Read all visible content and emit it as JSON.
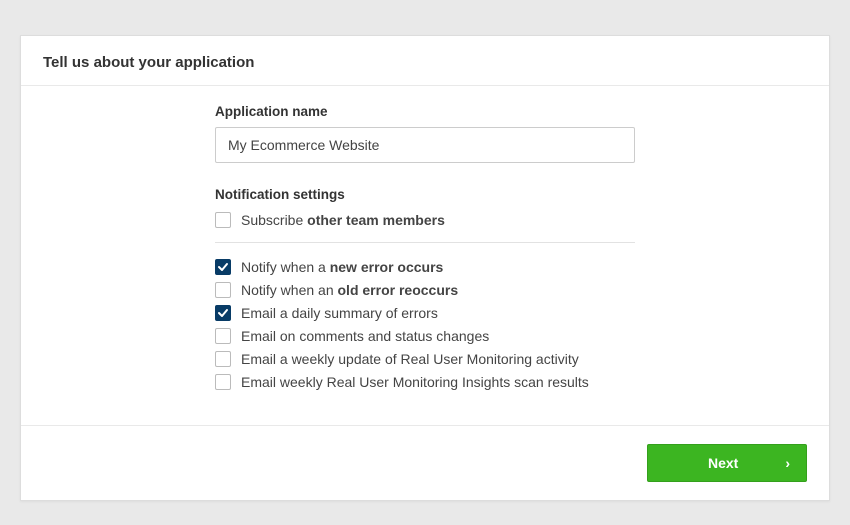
{
  "title": "Tell us about your application",
  "appName": {
    "label": "Application name",
    "value": "My Ecommerce Website"
  },
  "notification": {
    "heading": "Notification settings",
    "subscribe": {
      "checked": false,
      "prefix": "Subscribe ",
      "bold": "other team members",
      "suffix": ""
    },
    "options": [
      {
        "checked": true,
        "prefix": "Notify when a ",
        "bold": "new error occurs",
        "suffix": ""
      },
      {
        "checked": false,
        "prefix": "Notify when an ",
        "bold": "old error reoccurs",
        "suffix": ""
      },
      {
        "checked": true,
        "prefix": "Email a daily summary of errors",
        "bold": "",
        "suffix": ""
      },
      {
        "checked": false,
        "prefix": "Email on comments and status changes",
        "bold": "",
        "suffix": ""
      },
      {
        "checked": false,
        "prefix": "Email a weekly update of Real User Monitoring activity",
        "bold": "",
        "suffix": ""
      },
      {
        "checked": false,
        "prefix": "Email weekly Real User Monitoring Insights scan results",
        "bold": "",
        "suffix": ""
      }
    ]
  },
  "buttons": {
    "next": "Next"
  }
}
